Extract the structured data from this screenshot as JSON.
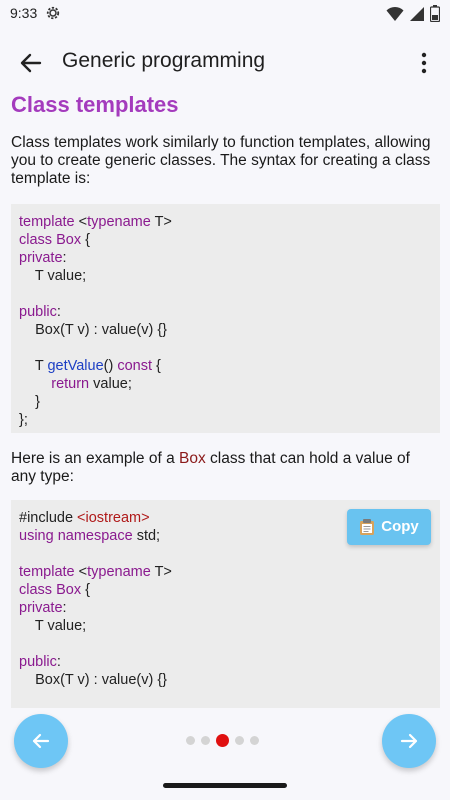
{
  "status_bar": {
    "time": "9:33",
    "icons": [
      "gear-icon",
      "wifi-icon",
      "cellular-icon",
      "battery-icon"
    ]
  },
  "app_bar": {
    "title": "Generic programming",
    "back_icon": "arrow-left-icon",
    "menu_icon": "more-vert-icon"
  },
  "content": {
    "section_title": "Class templates",
    "intro": "Class templates work similarly to function templates, allowing you to create generic classes. The syntax for creating a class template is:",
    "code1": [
      [
        {
          "t": "template ",
          "c": "kw"
        },
        {
          "t": "<"
        },
        {
          "t": "typename",
          "c": "kw"
        },
        {
          "t": " T>"
        }
      ],
      [
        {
          "t": "class ",
          "c": "kw"
        },
        {
          "t": "Box",
          "c": "kw"
        },
        {
          "t": " {"
        }
      ],
      [
        {
          "t": "private",
          "c": "kw"
        },
        {
          "t": ":"
        }
      ],
      [
        {
          "t": "    T value;"
        }
      ],
      [],
      [
        {
          "t": "public",
          "c": "kw"
        },
        {
          "t": ":"
        }
      ],
      [
        {
          "t": "    Box(T v) : value(v) {}"
        }
      ],
      [],
      [
        {
          "t": "    T "
        },
        {
          "t": "getValue",
          "c": "fn"
        },
        {
          "t": "() "
        },
        {
          "t": "const",
          "c": "kw"
        },
        {
          "t": " {"
        }
      ],
      [
        {
          "t": "        "
        },
        {
          "t": "return",
          "c": "kw"
        },
        {
          "t": " value;"
        }
      ],
      [
        {
          "t": "    }"
        }
      ],
      [
        {
          "t": "};"
        }
      ]
    ],
    "example_pre": "Here is an example of a ",
    "example_highlight": "Box",
    "example_post": " class that can hold a value of any type:",
    "copy_label": "Copy",
    "copy_icon": "clipboard-icon",
    "code2": [
      [
        {
          "t": "#include "
        },
        {
          "t": "<iostream>",
          "c": "str"
        }
      ],
      [
        {
          "t": "using",
          "c": "kw"
        },
        {
          "t": " "
        },
        {
          "t": "namespace",
          "c": "kw"
        },
        {
          "t": " std;"
        }
      ],
      [],
      [
        {
          "t": "template ",
          "c": "kw"
        },
        {
          "t": "<"
        },
        {
          "t": "typename",
          "c": "kw"
        },
        {
          "t": " T>"
        }
      ],
      [
        {
          "t": "class ",
          "c": "kw"
        },
        {
          "t": "Box",
          "c": "kw"
        },
        {
          "t": " {"
        }
      ],
      [
        {
          "t": "private",
          "c": "kw"
        },
        {
          "t": ":"
        }
      ],
      [
        {
          "t": "    T value;"
        }
      ],
      [],
      [
        {
          "t": "public",
          "c": "kw"
        },
        {
          "t": ":"
        }
      ],
      [
        {
          "t": "    Box(T v) : value(v) {}"
        }
      ]
    ]
  },
  "pager": {
    "total": 5,
    "current": 3,
    "prev_icon": "arrow-left-icon",
    "next_icon": "arrow-right-icon"
  },
  "colors": {
    "accent": "#a43bbd",
    "fab": "#6ec6f5",
    "active_dot": "#e01010"
  }
}
